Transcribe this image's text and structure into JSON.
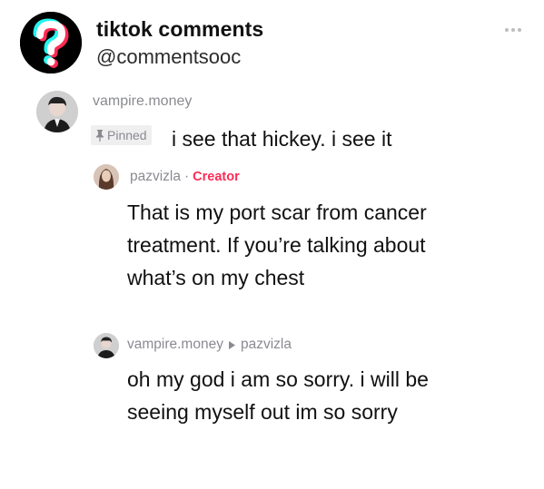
{
  "account": {
    "name": "tiktok comments",
    "handle": "@commentsooc"
  },
  "comment": {
    "username": "vampire.money",
    "pinned_label": "Pinned",
    "text": "i see that hickey. i see it"
  },
  "reply1": {
    "username": "pazvizla",
    "separator": "·",
    "creator_label": "Creator",
    "text": "That is my port scar from cancer treatment. If you’re talking about what’s on my chest"
  },
  "reply2": {
    "username": "vampire.money",
    "reply_to": "pazvizla",
    "text": "oh my god i am so sorry. i will be seeing myself out im so sorry"
  },
  "colors": {
    "creator": "#fe2c55",
    "muted": "#8a8b91",
    "logo_bg": "#000000"
  },
  "icons": [
    "question-mark-logo-icon",
    "more-dots-icon",
    "pin-icon",
    "reply-arrow-icon"
  ]
}
